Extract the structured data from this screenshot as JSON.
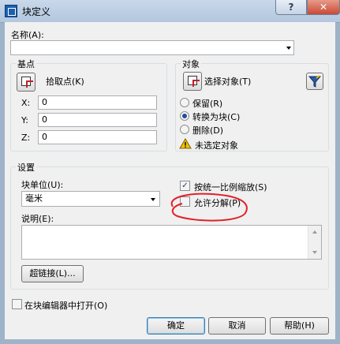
{
  "window": {
    "title": "块定义",
    "help_glyph": "?",
    "close_glyph": "✕"
  },
  "name": {
    "label": "名称(A):",
    "value": ""
  },
  "base_point": {
    "title": "基点",
    "pick_label": "拾取点(K)",
    "x_label": "X:",
    "x_value": "0",
    "y_label": "Y:",
    "y_value": "0",
    "z_label": "Z:",
    "z_value": "0"
  },
  "objects": {
    "title": "对象",
    "select_label": "选择对象(T)",
    "options": [
      {
        "label": "保留(R)",
        "selected": false
      },
      {
        "label": "转换为块(C)",
        "selected": true
      },
      {
        "label": "删除(D)",
        "selected": false
      }
    ],
    "warning": "未选定对象"
  },
  "settings": {
    "title": "设置",
    "unit_label": "块单位(U):",
    "unit_value": "毫米",
    "scale_uniform_label": "按统一比例缩放(S)",
    "scale_uniform_checked": true,
    "allow_explode_label": "允许分解(P)",
    "allow_explode_checked": false,
    "desc_label": "说明(E):",
    "hyperlink_label": "超链接(L)..."
  },
  "footer": {
    "open_in_editor_label": "在块编辑器中打开(O)",
    "ok_label": "确定",
    "cancel_label": "取消",
    "help_label": "帮助(H)"
  },
  "colors": {
    "annotation_circle": "#e0202a",
    "warning_yellow": "#f2c200"
  }
}
